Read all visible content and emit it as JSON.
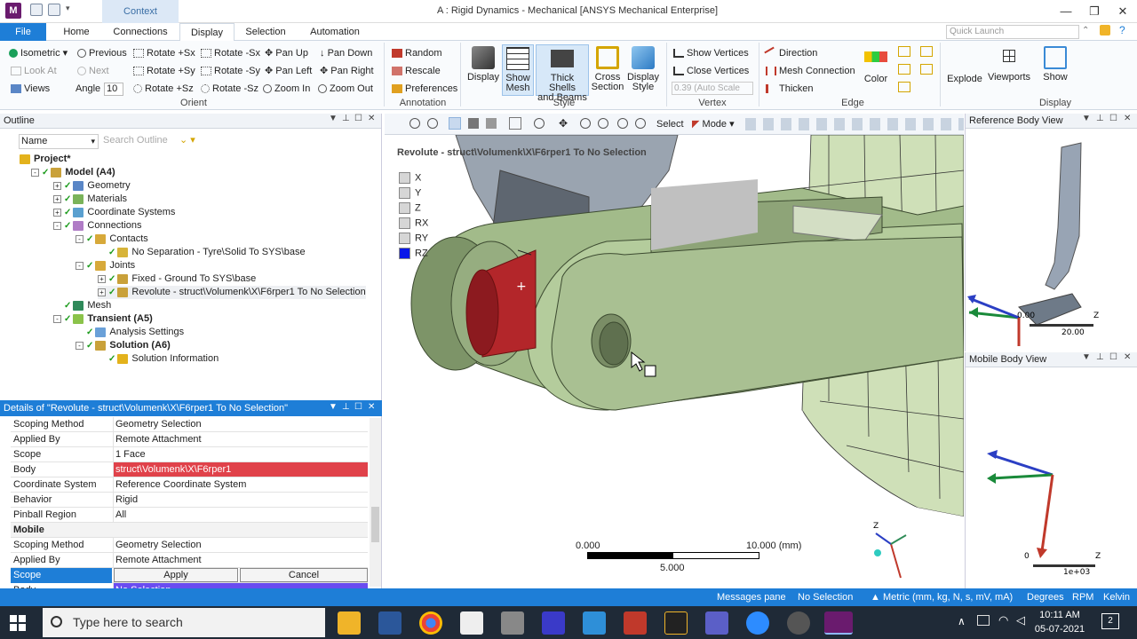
{
  "window": {
    "title": "A : Rigid Dynamics - Mechanical [ANSYS Mechanical Enterprise]",
    "app_letter": "M",
    "context_tab": "Context"
  },
  "menu": {
    "file": "File",
    "tabs": [
      "Home",
      "Connections",
      "Display",
      "Selection",
      "Automation"
    ],
    "active_tab": "Display",
    "quick_launch_placeholder": "Quick Launch"
  },
  "ribbon": {
    "orient": {
      "label": "Orient",
      "isometric": "Isometric",
      "look_at": "Look At",
      "views": "Views",
      "previous": "Previous",
      "next": "Next",
      "angle_label": "Angle",
      "angle_value": "10",
      "rot_px": "Rotate +Sx",
      "rot_nx": "Rotate -Sx",
      "rot_py": "Rotate +Sy",
      "rot_ny": "Rotate -Sy",
      "rot_pz": "Rotate +Sz",
      "rot_nz": "Rotate -Sz",
      "pan_up": "Pan Up",
      "pan_left": "Pan Left",
      "pan_down": "Pan Down",
      "pan_right": "Pan Right",
      "zoom_in": "Zoom In",
      "zoom_out": "Zoom Out"
    },
    "annotation": {
      "label": "Annotation",
      "random": "Random",
      "rescale": "Rescale",
      "preferences": "Preferences"
    },
    "style": {
      "label": "Style",
      "display": "Display",
      "show_mesh_1": "Show",
      "show_mesh_2": "Mesh",
      "thick_1": "Thick Shells",
      "thick_2": "and Beams",
      "cross_1": "Cross",
      "cross_2": "Section",
      "dstyle_1": "Display",
      "dstyle_2": "Style"
    },
    "vertex": {
      "label": "Vertex",
      "show_vertices": "Show Vertices",
      "close_vertices": "Close Vertices",
      "auto_scale": "0.39 (Auto Scale"
    },
    "edge": {
      "label": "Edge",
      "direction": "Direction",
      "mesh_connection": "Mesh Connection",
      "thicken": "Thicken",
      "color": "Color"
    },
    "display": {
      "label": "Display",
      "explode": "Explode",
      "viewports": "Viewports",
      "show": "Show"
    }
  },
  "outline": {
    "title": "Outline",
    "filter_name": "Name",
    "search_placeholder": "Search Outline",
    "tree": [
      {
        "label": "Project*",
        "bold": true,
        "indent": 0,
        "expander": "",
        "icon_color": "#e3b21c"
      },
      {
        "label": "Model (A4)",
        "bold": true,
        "indent": 1,
        "expander": "-",
        "icon_color": "#c9a13a"
      },
      {
        "label": "Geometry",
        "bold": false,
        "indent": 2,
        "expander": "+",
        "icon_color": "#5a86c6"
      },
      {
        "label": "Materials",
        "bold": false,
        "indent": 2,
        "expander": "+",
        "icon_color": "#7ab35a"
      },
      {
        "label": "Coordinate Systems",
        "bold": false,
        "indent": 2,
        "expander": "+",
        "icon_color": "#5aa0d0"
      },
      {
        "label": "Connections",
        "bold": false,
        "indent": 2,
        "expander": "-",
        "icon_color": "#b07cc6"
      },
      {
        "label": "Contacts",
        "bold": false,
        "indent": 3,
        "expander": "-",
        "icon_color": "#d7a93a"
      },
      {
        "label": "No Separation - Tyre\\Solid To SYS\\base",
        "bold": false,
        "indent": 4,
        "expander": "",
        "icon_color": "#d7b43a"
      },
      {
        "label": "Joints",
        "bold": false,
        "indent": 3,
        "expander": "-",
        "icon_color": "#d7a93a"
      },
      {
        "label": "Fixed - Ground To SYS\\base",
        "bold": false,
        "indent": 4,
        "expander": "+",
        "icon_color": "#c9a13a"
      },
      {
        "label": "Revolute - struct\\Volumenk\\X\\F6rper1 To No Selection",
        "bold": false,
        "indent": 4,
        "expander": "+",
        "icon_color": "#c9a13a",
        "selected": true
      },
      {
        "label": "Mesh",
        "bold": false,
        "indent": 2,
        "expander": "",
        "icon_color": "#2f8a5a"
      },
      {
        "label": "Transient (A5)",
        "bold": true,
        "indent": 2,
        "expander": "-",
        "icon_color": "#8bc34a"
      },
      {
        "label": "Analysis Settings",
        "bold": false,
        "indent": 3,
        "expander": "",
        "icon_color": "#6aa0d8"
      },
      {
        "label": "Solution (A6)",
        "bold": true,
        "indent": 3,
        "expander": "-",
        "icon_color": "#c9a13a"
      },
      {
        "label": "Solution Information",
        "bold": false,
        "indent": 4,
        "expander": "",
        "icon_color": "#e3b21c"
      }
    ]
  },
  "details": {
    "title": "Details of \"Revolute - struct\\Volumenk\\X\\F6rper1 To No Selection\"",
    "rows": [
      {
        "key": "Scoping Method",
        "value": "Geometry Selection",
        "style": ""
      },
      {
        "key": "Applied By",
        "value": "Remote Attachment",
        "style": ""
      },
      {
        "key": "Scope",
        "value": "1 Face",
        "style": ""
      },
      {
        "key": "Body",
        "value": "struct\\Volumenk\\X\\F6rper1",
        "style": "red"
      },
      {
        "key": "Coordinate System",
        "value": "Reference Coordinate System",
        "style": ""
      },
      {
        "key": "Behavior",
        "value": "Rigid",
        "style": ""
      },
      {
        "key": "Pinball Region",
        "value": "All",
        "style": ""
      },
      {
        "key": "Mobile",
        "value": "",
        "style": "section"
      },
      {
        "key": "Scoping Method",
        "value": "Geometry Selection",
        "style": ""
      },
      {
        "key": "Applied By",
        "value": "Remote Attachment",
        "style": ""
      },
      {
        "key": "Scope",
        "value": "",
        "style": "apply"
      },
      {
        "key": "Body",
        "value": "No Selection",
        "style": "purple"
      }
    ],
    "apply": "Apply",
    "cancel": "Cancel"
  },
  "viewport": {
    "label": "Revolute - struct\\Volumenk\\X\\F6rper1 To No Selection",
    "dof": [
      "X",
      "Y",
      "Z",
      "RX",
      "RY",
      "RZ"
    ],
    "dof_active": "RZ",
    "toolbar": {
      "select": "Select",
      "mode": "Mode"
    },
    "scale_left": "0.000",
    "scale_right": "10.000 (mm)",
    "scale_mid": "5.000",
    "triad_z": "Z"
  },
  "ref_body_view": {
    "title": "Reference Body View",
    "scale_left": "0.00",
    "scale_right": "20.00",
    "triad": "Z"
  },
  "mobile_body_view": {
    "title": "Mobile Body View",
    "scale_left": "0",
    "scale_right": "1e+03",
    "triad": "Z"
  },
  "status": {
    "messages": "Messages pane",
    "selection": "No Selection",
    "units": "Metric (mm, kg, N, s, mV, mA)",
    "degrees": "Degrees",
    "rpm": "RPM",
    "kelvin": "Kelvin"
  },
  "taskbar": {
    "search": "Type here to search",
    "time": "10:11 AM",
    "date": "05-07-2021",
    "notification_count": "2"
  }
}
